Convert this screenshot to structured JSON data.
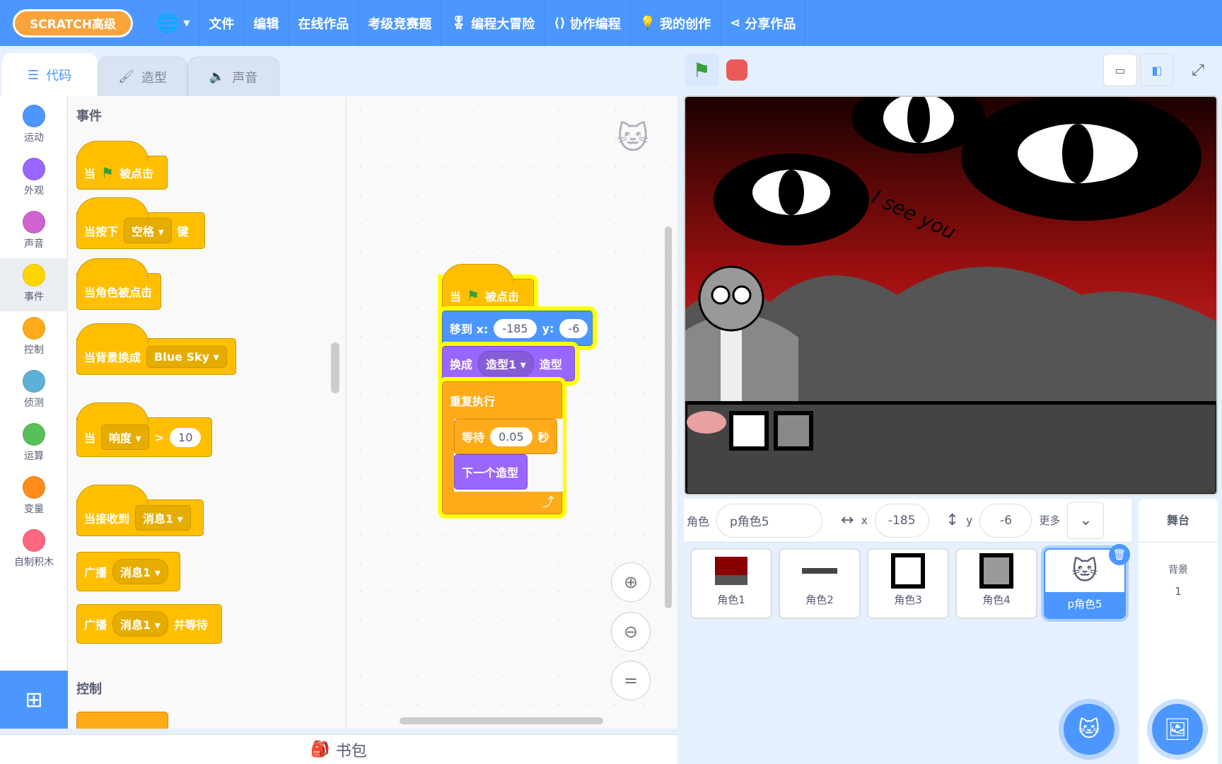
{
  "header": {
    "logo": "SCRATCH高级",
    "menus": [
      "文件",
      "编辑",
      "在线作品",
      "考级竞赛题",
      "编程大冒险",
      "协作编程",
      "我的创作",
      "分享作品"
    ]
  },
  "tabs": {
    "code": "代码",
    "costumes": "造型",
    "sounds": "声音"
  },
  "categories": [
    {
      "label": "运动",
      "color": "#4c97ff"
    },
    {
      "label": "外观",
      "color": "#9966ff"
    },
    {
      "label": "声音",
      "color": "#cf63cf"
    },
    {
      "label": "事件",
      "color": "#ffd500"
    },
    {
      "label": "控制",
      "color": "#ffab19"
    },
    {
      "label": "侦测",
      "color": "#5cb1d6"
    },
    {
      "label": "运算",
      "color": "#59c059"
    },
    {
      "label": "变量",
      "color": "#ff8c1a"
    },
    {
      "label": "自制积木",
      "color": "#ff6680"
    }
  ],
  "palette": {
    "section_events": "事件",
    "section_control": "控制",
    "b1": {
      "pre": "当",
      "post": "被点击"
    },
    "b2": {
      "pre": "当按下",
      "key": "空格",
      "post": "键"
    },
    "b3": {
      "text": "当角色被点击"
    },
    "b4": {
      "pre": "当背景换成",
      "value": "Blue Sky"
    },
    "b5": {
      "pre": "当",
      "sensor": "响度",
      "op": ">",
      "value": "10"
    },
    "b6": {
      "pre": "当接收到",
      "msg": "消息1"
    },
    "b7": {
      "pre": "广播",
      "msg": "消息1"
    },
    "b8": {
      "pre": "广播",
      "msg": "消息1",
      "post": "并等待"
    }
  },
  "script": {
    "hat": {
      "pre": "当",
      "post": "被点击"
    },
    "move": {
      "label": "移到 x:",
      "x": "-185",
      "ylabel": "y:",
      "y": "-6"
    },
    "costume": {
      "pre": "换成",
      "value": "造型1",
      "post": "造型"
    },
    "forever": "重复执行",
    "wait": {
      "pre": "等待",
      "value": "0.05",
      "post": "秒"
    },
    "next": "下一个造型"
  },
  "backpack": "书包",
  "stage": {
    "text": "I see you"
  },
  "sprite_info": {
    "label": "角色",
    "name": "p角色5",
    "x": "-185",
    "y": "-6",
    "xl": "x",
    "yl": "y",
    "more": "更多"
  },
  "sprites": [
    "角色1",
    "角色2",
    "角色3",
    "角色4",
    "p角色5"
  ],
  "stage_panel": {
    "title": "舞台",
    "backdrop_label": "背景",
    "backdrop_count": "1"
  }
}
